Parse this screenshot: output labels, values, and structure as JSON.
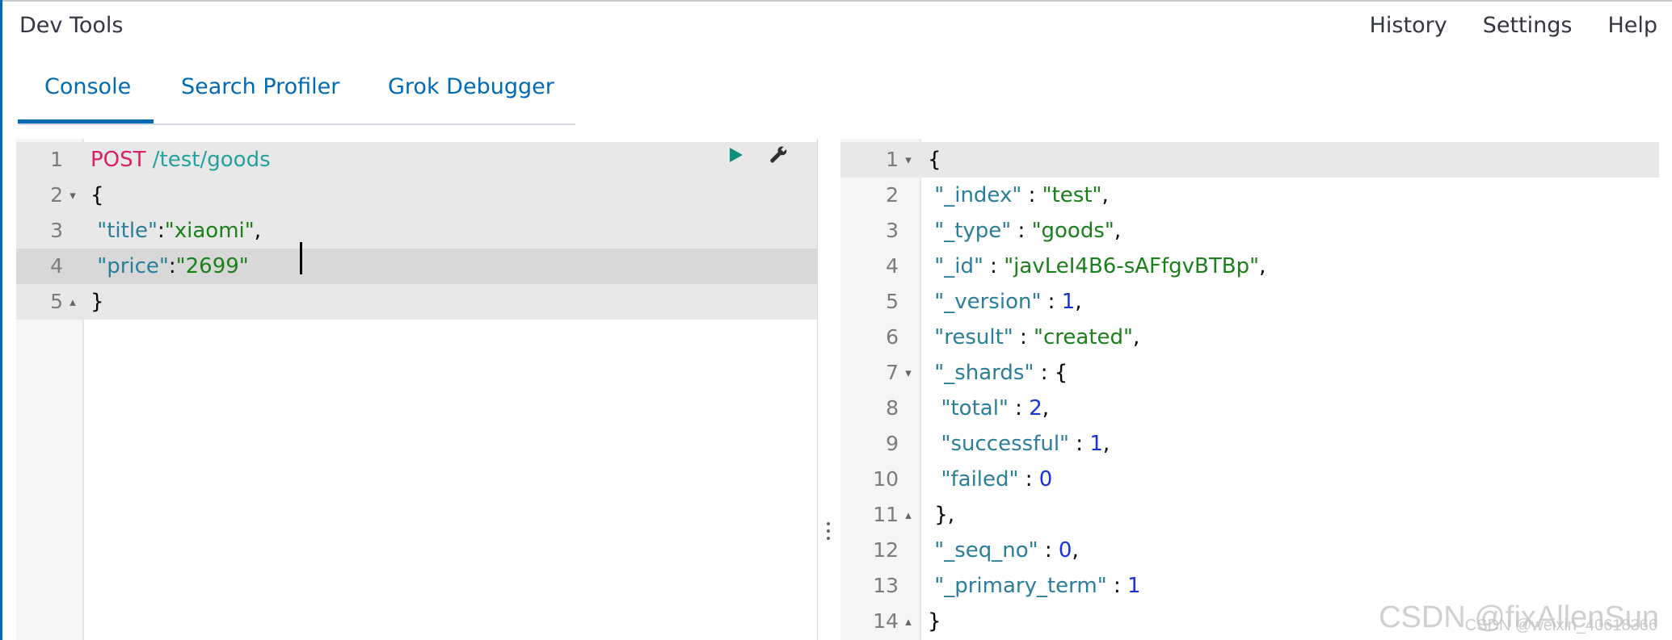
{
  "app": {
    "title": "Dev Tools"
  },
  "top_nav": {
    "items": [
      {
        "label": "History"
      },
      {
        "label": "Settings"
      },
      {
        "label": "Help"
      }
    ]
  },
  "tabs": [
    {
      "label": "Console",
      "active": true
    },
    {
      "label": "Search Profiler",
      "active": false
    },
    {
      "label": "Grok Debugger",
      "active": false
    }
  ],
  "editor": {
    "lines": [
      {
        "no": "1",
        "fold": "",
        "parts": [
          {
            "text": "POST",
            "cls": "method"
          },
          {
            "text": " ",
            "cls": "punc"
          },
          {
            "text": "/test/goods",
            "cls": "path"
          }
        ]
      },
      {
        "no": "2",
        "fold": "▾",
        "parts": [
          {
            "text": "{",
            "cls": "punc"
          }
        ]
      },
      {
        "no": "3",
        "fold": "",
        "parts": [
          {
            "text": " ",
            "cls": "punc"
          },
          {
            "text": "\"title\"",
            "cls": "key"
          },
          {
            "text": ":",
            "cls": "punc"
          },
          {
            "text": "\"xiaomi\"",
            "cls": "str"
          },
          {
            "text": ",",
            "cls": "punc"
          }
        ]
      },
      {
        "no": "4",
        "fold": "",
        "parts": [
          {
            "text": " ",
            "cls": "punc"
          },
          {
            "text": "\"price\"",
            "cls": "key"
          },
          {
            "text": ":",
            "cls": "punc"
          },
          {
            "text": "\"2699\"",
            "cls": "str"
          }
        ]
      },
      {
        "no": "5",
        "fold": "▴",
        "parts": [
          {
            "text": "}",
            "cls": "punc"
          }
        ]
      }
    ],
    "highlight_lines": [
      0,
      1,
      2,
      3,
      4
    ],
    "active_line": 3
  },
  "response": {
    "lines": [
      {
        "no": "1",
        "fold": "▾",
        "parts": [
          {
            "text": "{",
            "cls": "punc"
          }
        ]
      },
      {
        "no": "2",
        "fold": "",
        "parts": [
          {
            "text": " ",
            "cls": "punc"
          },
          {
            "text": "\"_index\"",
            "cls": "key"
          },
          {
            "text": " : ",
            "cls": "punc"
          },
          {
            "text": "\"test\"",
            "cls": "str"
          },
          {
            "text": ",",
            "cls": "punc"
          }
        ]
      },
      {
        "no": "3",
        "fold": "",
        "parts": [
          {
            "text": " ",
            "cls": "punc"
          },
          {
            "text": "\"_type\"",
            "cls": "key"
          },
          {
            "text": " : ",
            "cls": "punc"
          },
          {
            "text": "\"goods\"",
            "cls": "str"
          },
          {
            "text": ",",
            "cls": "punc"
          }
        ]
      },
      {
        "no": "4",
        "fold": "",
        "parts": [
          {
            "text": " ",
            "cls": "punc"
          },
          {
            "text": "\"_id\"",
            "cls": "key"
          },
          {
            "text": " : ",
            "cls": "punc"
          },
          {
            "text": "\"javLeI4B6-sAFfgvBTBp\"",
            "cls": "str"
          },
          {
            "text": ",",
            "cls": "punc"
          }
        ]
      },
      {
        "no": "5",
        "fold": "",
        "parts": [
          {
            "text": " ",
            "cls": "punc"
          },
          {
            "text": "\"_version\"",
            "cls": "key"
          },
          {
            "text": " : ",
            "cls": "punc"
          },
          {
            "text": "1",
            "cls": "num"
          },
          {
            "text": ",",
            "cls": "punc"
          }
        ]
      },
      {
        "no": "6",
        "fold": "",
        "parts": [
          {
            "text": " ",
            "cls": "punc"
          },
          {
            "text": "\"result\"",
            "cls": "key"
          },
          {
            "text": " : ",
            "cls": "punc"
          },
          {
            "text": "\"created\"",
            "cls": "str"
          },
          {
            "text": ",",
            "cls": "punc"
          }
        ]
      },
      {
        "no": "7",
        "fold": "▾",
        "parts": [
          {
            "text": " ",
            "cls": "punc"
          },
          {
            "text": "\"_shards\"",
            "cls": "key"
          },
          {
            "text": " : {",
            "cls": "punc"
          }
        ]
      },
      {
        "no": "8",
        "fold": "",
        "parts": [
          {
            "text": "  ",
            "cls": "punc"
          },
          {
            "text": "\"total\"",
            "cls": "key"
          },
          {
            "text": " : ",
            "cls": "punc"
          },
          {
            "text": "2",
            "cls": "num"
          },
          {
            "text": ",",
            "cls": "punc"
          }
        ]
      },
      {
        "no": "9",
        "fold": "",
        "parts": [
          {
            "text": "  ",
            "cls": "punc"
          },
          {
            "text": "\"successful\"",
            "cls": "key"
          },
          {
            "text": " : ",
            "cls": "punc"
          },
          {
            "text": "1",
            "cls": "num"
          },
          {
            "text": ",",
            "cls": "punc"
          }
        ]
      },
      {
        "no": "10",
        "fold": "",
        "parts": [
          {
            "text": "  ",
            "cls": "punc"
          },
          {
            "text": "\"failed\"",
            "cls": "key"
          },
          {
            "text": " : ",
            "cls": "punc"
          },
          {
            "text": "0",
            "cls": "num"
          }
        ]
      },
      {
        "no": "11",
        "fold": "▴",
        "parts": [
          {
            "text": " ",
            "cls": "punc"
          },
          {
            "text": "},",
            "cls": "punc"
          }
        ]
      },
      {
        "no": "12",
        "fold": "",
        "parts": [
          {
            "text": " ",
            "cls": "punc"
          },
          {
            "text": "\"_seq_no\"",
            "cls": "key"
          },
          {
            "text": " : ",
            "cls": "punc"
          },
          {
            "text": "0",
            "cls": "num"
          },
          {
            "text": ",",
            "cls": "punc"
          }
        ]
      },
      {
        "no": "13",
        "fold": "",
        "parts": [
          {
            "text": " ",
            "cls": "punc"
          },
          {
            "text": "\"_primary_term\"",
            "cls": "key"
          },
          {
            "text": " : ",
            "cls": "punc"
          },
          {
            "text": "1",
            "cls": "num"
          }
        ]
      },
      {
        "no": "14",
        "fold": "▴",
        "parts": [
          {
            "text": "}",
            "cls": "punc"
          }
        ]
      }
    ],
    "highlight_lines": [
      0
    ]
  },
  "icons": {
    "run": "play-icon",
    "settings": "wrench-icon",
    "resizer": "vertical-ellipsis-icon"
  },
  "watermark": {
    "main": "CSDN @fixAllenSun",
    "sub": "CSDN @weixin_40618366"
  },
  "colors": {
    "accent": "#006bb4",
    "method": "#d91f67",
    "path": "#24a19b",
    "key": "#2a7e99",
    "string": "#1b7f1b",
    "number": "#1734d7"
  }
}
